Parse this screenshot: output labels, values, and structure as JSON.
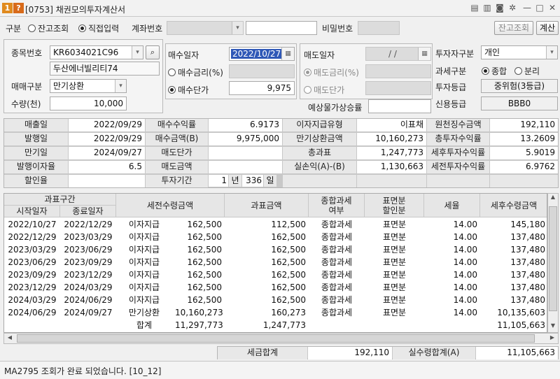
{
  "window": {
    "badge1": "1",
    "badge2": "?",
    "title": "[0753] 채권모의투자계산서",
    "ctrl_icons": [
      "copy-icon",
      "paste-icon",
      "camera-icon",
      "gear-icon"
    ],
    "minimize": "—",
    "maximize": "□",
    "close": "✕"
  },
  "topbar": {
    "type_label": "구분",
    "opt_balance": "잔고조회",
    "opt_direct": "직접입력",
    "account_label": "계좌번호",
    "password_label": "비밀번호",
    "balance_btn": "잔고조회",
    "calc_btn": "계산"
  },
  "stock": {
    "code_label": "종목번호",
    "code": "KR6034021C96",
    "name": "두산에너빌리티74",
    "trade_type_label": "매매구분",
    "trade_type": "만기상환",
    "qty_label": "수량(천)",
    "qty": "10,000"
  },
  "buy": {
    "date_label": "매수일자",
    "date": "2022/10/27",
    "rate_label": "매수금리(%)",
    "price_label": "매수단가",
    "price": "9,975"
  },
  "sell": {
    "date_label": "매도일자",
    "date": "/ /",
    "rate_label": "매도금리(%)",
    "price_label": "매도단가",
    "expected_label": "예상물가상승률"
  },
  "investor": {
    "type_label": "투자자구분",
    "type": "개인",
    "tax_label": "과세구분",
    "tax_opt1": "종합",
    "tax_opt2": "분리",
    "grade_label": "투자등급",
    "grade": "중위험(3등급)",
    "credit_label": "신용등급",
    "credit": "BBB0"
  },
  "info": [
    [
      "매출일",
      "2022/09/29",
      "매수수익률",
      "6.9173",
      "이자지급유형",
      "이표채",
      "원천징수금액",
      "192,110"
    ],
    [
      "발행일",
      "2022/09/29",
      "매수금액(B)",
      "9,975,000",
      "만기상환금액",
      "10,160,273",
      "총투자수익률",
      "13.2609"
    ],
    [
      "만기일",
      "2024/09/27",
      "매도단가",
      "",
      "총과표",
      "1,247,773",
      "세후투자수익률",
      "5.9019"
    ],
    [
      "발행이자율",
      "6.5",
      "매도금액",
      "",
      "실손익(A)-(B)",
      "1,130,663",
      "세전투자수익률",
      "6.9762"
    ],
    [
      "할인율",
      "",
      "투자기간",
      "",
      "",
      "",
      "",
      ""
    ]
  ],
  "period": {
    "years": "1",
    "years_unit": "년",
    "days": "336",
    "days_unit": "일"
  },
  "table": {
    "group_header": "과표구간",
    "headers": [
      "시작일자",
      "종료일자",
      "세전수령금액",
      "과표금액",
      "종합과세\n여부",
      "표면분\n할인분",
      "세율",
      "세후수령금액"
    ],
    "rows": [
      [
        "2022/10/27",
        "2022/12/29",
        "이자지급",
        "162,500",
        "112,500",
        "종합과세",
        "표면분",
        "14.00",
        "145,180"
      ],
      [
        "2022/12/29",
        "2023/03/29",
        "이자지급",
        "162,500",
        "162,500",
        "종합과세",
        "표면분",
        "14.00",
        "137,480"
      ],
      [
        "2023/03/29",
        "2023/06/29",
        "이자지급",
        "162,500",
        "162,500",
        "종합과세",
        "표면분",
        "14.00",
        "137,480"
      ],
      [
        "2023/06/29",
        "2023/09/29",
        "이자지급",
        "162,500",
        "162,500",
        "종합과세",
        "표면분",
        "14.00",
        "137,480"
      ],
      [
        "2023/09/29",
        "2023/12/29",
        "이자지급",
        "162,500",
        "162,500",
        "종합과세",
        "표면분",
        "14.00",
        "137,480"
      ],
      [
        "2023/12/29",
        "2024/03/29",
        "이자지급",
        "162,500",
        "162,500",
        "종합과세",
        "표면분",
        "14.00",
        "137,480"
      ],
      [
        "2024/03/29",
        "2024/06/29",
        "이자지급",
        "162,500",
        "162,500",
        "종합과세",
        "표면분",
        "14.00",
        "137,480"
      ],
      [
        "2024/06/29",
        "2024/09/27",
        "만기상환",
        "10,160,273",
        "160,273",
        "종합과세",
        "표면분",
        "14.00",
        "10,135,603"
      ]
    ],
    "total": [
      "",
      "",
      "합계",
      "11,297,773",
      "1,247,773",
      "",
      "",
      "",
      "11,105,663"
    ]
  },
  "footer": {
    "tax_total_label": "세금합계",
    "tax_total": "192,110",
    "net_total_label": "실수령합계(A)",
    "net_total": "11,105,663"
  },
  "status": {
    "message": "MA2795 조회가 완료 되었습니다. [10_12]"
  }
}
